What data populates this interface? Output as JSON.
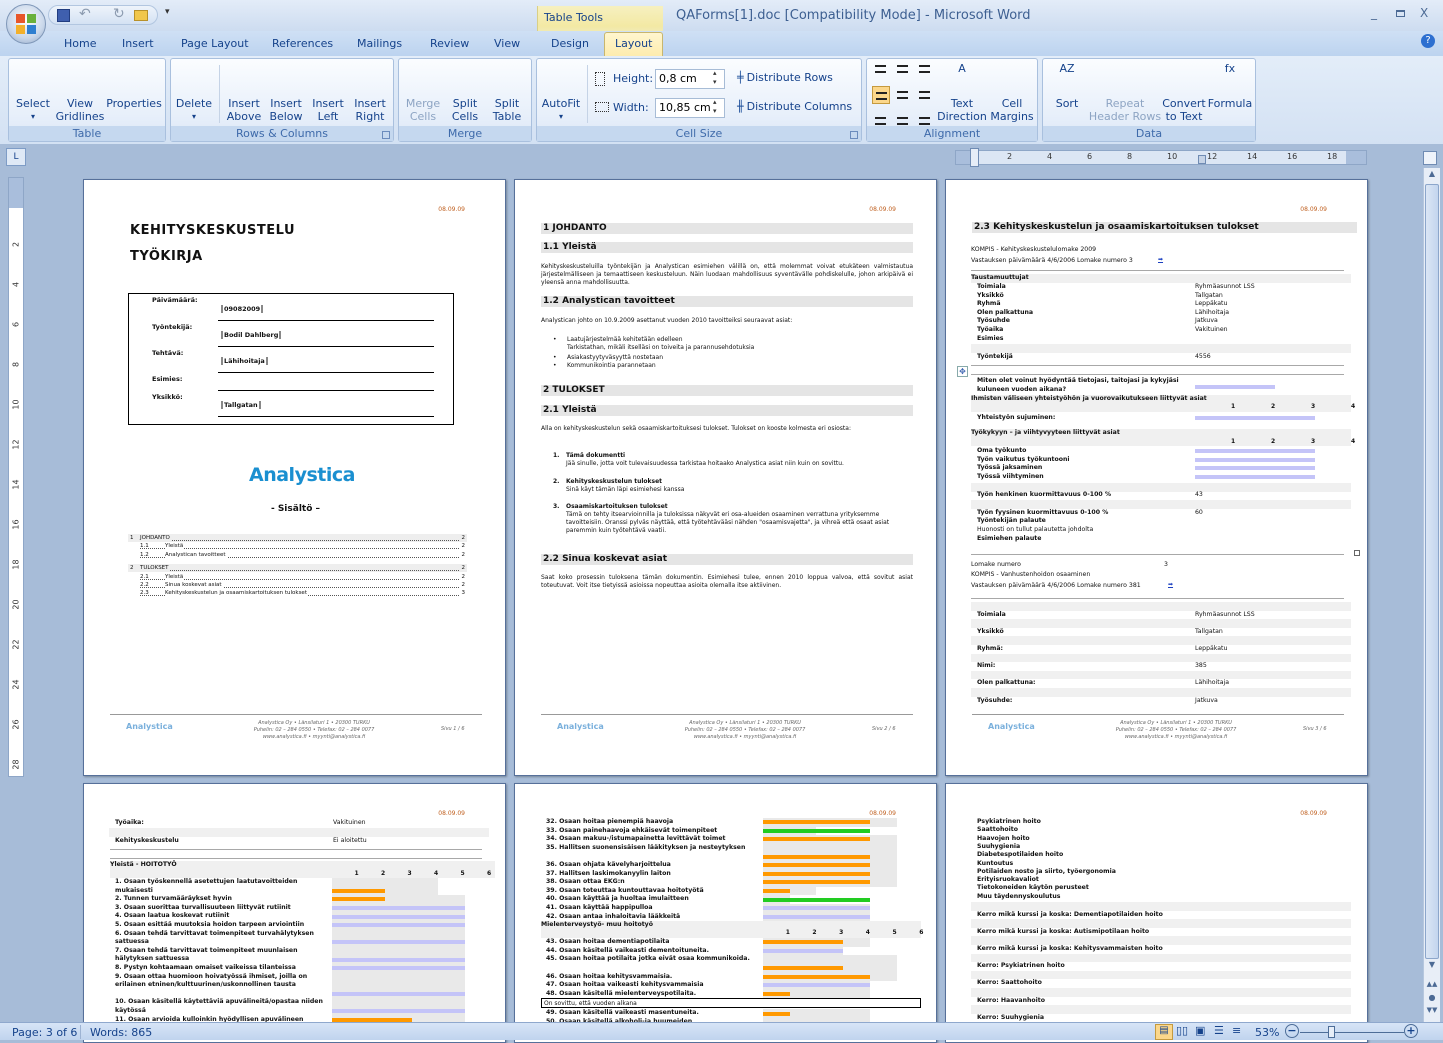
{
  "window": {
    "title": "QAForms[1].doc [Compatibility Mode] - Microsoft Word",
    "context_tab": "Table Tools"
  },
  "tabs": [
    "Home",
    "Insert",
    "Page Layout",
    "References",
    "Mailings",
    "Review",
    "View",
    "Design",
    "Layout"
  ],
  "active_tab": "Layout",
  "ribbon": {
    "groups": [
      "Table",
      "Rows & Columns",
      "Merge",
      "Cell Size",
      "Alignment",
      "Data"
    ],
    "buttons": {
      "select": "Select",
      "view_gridlines": [
        "View",
        "Gridlines"
      ],
      "properties": "Properties",
      "delete": "Delete",
      "insert_above": [
        "Insert",
        "Above"
      ],
      "insert_below": [
        "Insert",
        "Below"
      ],
      "insert_left": [
        "Insert",
        "Left"
      ],
      "insert_right": [
        "Insert",
        "Right"
      ],
      "merge_cells": [
        "Merge",
        "Cells"
      ],
      "split_cells": [
        "Split",
        "Cells"
      ],
      "split_table": [
        "Split",
        "Table"
      ],
      "autofit": "AutoFit",
      "text_direction": [
        "Text",
        "Direction"
      ],
      "cell_margins": [
        "Cell",
        "Margins"
      ],
      "sort": "Sort",
      "repeat_header_rows": [
        "Repeat",
        "Header Rows"
      ],
      "convert_to_text": [
        "Convert",
        "to Text"
      ],
      "formula": "Formula"
    },
    "cell_size": {
      "height_label": "Height:",
      "height": "0,8 cm",
      "width_label": "Width:",
      "width": "10,85 cm",
      "distribute_rows": "Distribute Rows",
      "distribute_columns": "Distribute Columns"
    },
    "disabled": [
      "merge_cells",
      "repeat_header_rows"
    ]
  },
  "ruler": {
    "h": [
      "2",
      "4",
      "6",
      "8",
      "10",
      "12",
      "14",
      "16",
      "18"
    ],
    "v": [
      "2",
      "4",
      "6",
      "8",
      "10",
      "12",
      "14",
      "16",
      "18",
      "20",
      "22",
      "24",
      "26",
      "28"
    ]
  },
  "footer": {
    "logo": "Analystica",
    "line1": "Analystica Oy • Länsilaturi 1 • 20300 TURKU",
    "line2": "Puhelin: 02 – 284 0550 • Telefax: 02 – 284 0077",
    "line3": "www.analystica.fi • myynti@analystica.fi"
  },
  "date": "08.09.09",
  "p1": {
    "title1": "KEHITYSKESKUSTELU",
    "title2": "TYÖKIRJA",
    "form": [
      [
        "Päivämäärä:",
        "09082009"
      ],
      [
        "Työntekijä:",
        "Bodil Dahlberg"
      ],
      [
        "Tehtävä:",
        "Lähihoitaja"
      ],
      [
        "Esimies:",
        ""
      ],
      [
        "Yksikkö:",
        "Tallgatan"
      ]
    ],
    "logo": "Analystica",
    "toc_title": "- Sisältö –",
    "toc": [
      [
        "1",
        "JOHDANTO",
        "2",
        true
      ],
      [
        "1.1",
        "Yleistä",
        "2",
        false
      ],
      [
        "1.2",
        "Analystican tavoitteet",
        "2",
        false
      ],
      [
        "2",
        "TULOKSET",
        "2",
        true
      ],
      [
        "2.1",
        "Yleistä",
        "2",
        false
      ],
      [
        "2.2",
        "Sinua koskevat asiat",
        "2",
        false
      ],
      [
        "2.3",
        "Kehityskeskustelun ja osaamiskartoituksen tulokset",
        "3",
        false
      ]
    ],
    "page_no": "Sivu 1 / 6"
  },
  "p2": {
    "h1": "1   JOHDANTO",
    "h11": "1.1   Yleistä",
    "p11": "Kehityskeskusteluilla työntekijän ja Analystican esimiehen välillä on, että molemmat voivat etukäteen valmistautua järjestelmälliseen ja temaattiseen keskusteluun. Näin luodaan mahdollisuus syventävälle pohdiskelulle, johon arkipäivä ei yleensä anna mahdollisuutta.",
    "h12": "1.2   Analystican tavoitteet",
    "p12": "Analystican johto on 10.9.2009 asettanut vuoden 2010 tavoitteiksi seuraavat asiat:",
    "bullets": [
      "Laatujärjestelmää kehitetään edelleen\nTarkistathan, mikäli itselläsi on toiveita ja parannusehdotuksia",
      "Asiakastyytyväsyyttä nostetaan",
      "Kommunikointia parannetaan"
    ],
    "h2": "2   TULOKSET",
    "h21": "2.1   Yleistä",
    "p21": "Alla on kehityskeskustelun sekä osaamiskartoituksesi tulokset. Tulokset on kooste kolmesta eri osiosta:",
    "numbered": [
      [
        "Tämä dokumentti",
        "Jää sinulle, jotta voit tulevaisuudessa tarkistaa hoitaako Analystica asiat niin kuin on sovittu."
      ],
      [
        "Kehityskeskustelun tulokset",
        "Sinä käyt tämän läpi esimiehesi kanssa"
      ],
      [
        "Osaamiskartoituksen tulokset",
        "Tämä on tehty itsearvioinnilla ja tuloksissa näkyvät eri osa-alueiden osaaminen verrattuna yrityksemme tavoitteisiin. Oranssi pylväs näyttää, että työtehtävääsi nähden \"osaamisvajetta\", ja vihreä että osaat asiat paremmin kuin työtehtävä vaatii."
      ]
    ],
    "h22": "2.2   Sinua koskevat asiat",
    "p22": "Saat koko prosessin tuloksena tämän dokumentin. Esimiehesi tulee, ennen 2010 loppua valvoa, että sovitut asiat toteutuvat. Voit itse tietyissä asioissa nopeuttaa asioita olemalla itse aktiivinen.",
    "page_no": "Sivu 2 / 6"
  },
  "p3": {
    "heading": "2.3   Kehityskeskustelun ja osaamiskartoituksen tulokset",
    "form1": "KOMPIS - Kehityskeskustelulomake  2009",
    "resp1": "Vastauksen päivämäärä  4/6/2006   Lomake numero  3",
    "bg_title": "Taustamuuttujat",
    "bg_rows": [
      [
        "Toimiala",
        "Ryhmäasunnot  LSS"
      ],
      [
        "Yksikkö",
        "Tallgatan"
      ],
      [
        "Ryhmä",
        "Leppäkatu"
      ],
      [
        "Olen palkattuna",
        "Lähihoitaja"
      ],
      [
        "Työsuhde",
        "Jatkuva"
      ],
      [
        "Työaika",
        "Vakituinen"
      ],
      [
        "Esimies",
        ""
      ]
    ],
    "employee": [
      "Työntekijä",
      "4556"
    ],
    "q1": "Miten olet voinut hyödyntää tietojasi, taitojasi ja kykyjäsi kuluneen vuoden aikana?",
    "q1_value": 2,
    "sec2": "Ihmisten väliseen yhteistyöhön ja vuorovaikutukseen liittyvät asiat",
    "scale": [
      "1",
      "2",
      "3",
      "4"
    ],
    "q2": [
      "Yhteistyön sujuminen:",
      3
    ],
    "sec3": "Työkykyyn – ja viihtyvyyteen liittyvät asiat",
    "q3": [
      [
        "Oma työkunto",
        3
      ],
      [
        "Työn vaikutus työkuntooni",
        3
      ],
      [
        "Työssä jaksaminen",
        3
      ],
      [
        "Työssä viihtyminen",
        3
      ]
    ],
    "mental": [
      "Työn henkinen kuormittavuus 0-100 %",
      "43"
    ],
    "physical": [
      "Työn fyysinen kuormittavuus 0-100 %",
      "60"
    ],
    "emp_feedback_label": "Työntekijän palaute",
    "emp_feedback": "Huonosti on tullut palautetta johdolta",
    "sup_feedback_label": "Esimiehen palaute",
    "form2_no": [
      "Lomake numero",
      "3"
    ],
    "form2": "KOMPIS - Vanhustenhoidon  osaaminen",
    "resp2": "Vastauksen päivämäärä  4/6/2006   Lomake numero  381",
    "rows2": [
      [
        "Toimiala",
        "Ryhmäasunnot  LSS"
      ],
      [
        "Yksikkö",
        "Tallgatan"
      ],
      [
        "Ryhmä:",
        "Leppäkatu"
      ],
      [
        "Nimi:",
        "385"
      ],
      [
        "Olen palkattuna:",
        "Lähihoitaja"
      ],
      [
        "Työsuhde:",
        "Jatkuva"
      ]
    ],
    "page_no": "Sivu 3 / 6"
  },
  "colors": {
    "gap": "#ff9900",
    "surplus": "#22cc22",
    "match": "#c4c4f8",
    "target": "#e9e9e9",
    "accent": "#15428b"
  },
  "p4": {
    "rows": [
      [
        "Työaika:",
        "Vakituinen"
      ],
      [
        "Kehityskeskustelu",
        "Ei aloitettu"
      ]
    ],
    "section": "Yleistä - HOITOTYÖ",
    "scale": [
      "1",
      "2",
      "3",
      "4",
      "5",
      "6"
    ],
    "items": [
      {
        "text": "1. Osaan työskennellä asetettujen laatutavoitteiden mukaisesti",
        "lines": 2,
        "value": 2,
        "color": "gap",
        "target": 4
      },
      {
        "text": "2. Tunnen turvamääräykset hyvin",
        "lines": 1,
        "value": 2,
        "color": "gap",
        "target": 5
      },
      {
        "text": "3. Osaan suorittaa turvallisuuteen liittyvät rutiinit",
        "lines": 1,
        "value": 5,
        "color": "match",
        "target": 5
      },
      {
        "text": "4. Osaan laatua koskevat rutiinit",
        "lines": 1,
        "value": 5,
        "color": "match",
        "target": 5
      },
      {
        "text": "5. Osaan esittää muutoksia hoidon tarpeen arviointiin",
        "lines": 1,
        "value": 5,
        "color": "match",
        "target": 5
      },
      {
        "text": "6. Osaan tehdä tarvittavat toimenpiteet turvahälytyksen sattuessa",
        "lines": 2,
        "value": 5,
        "color": "match",
        "target": 5
      },
      {
        "text": "7. Osaan tehdä tarvittavat toimenpiteet muunlaisen hälytyksen sattuessa",
        "lines": 2,
        "value": 5,
        "color": "match",
        "target": 5
      },
      {
        "text": "8. Pystyn kohtaamaan omaiset vaikeissa tilanteissa",
        "lines": 1,
        "value": 5,
        "color": "match",
        "target": 5
      },
      {
        "text": "9. Osaan ottaa huomioon hoivatyössä ihmiset, joilla on erilainen etninen/kulttuurinen/uskonnollinen tausta",
        "lines": 3,
        "value": 5,
        "color": "match",
        "target": 5
      },
      {
        "text": "10. Osaan käsitellä käytettäviä apuvälineitä/opastaa niiden käytössä",
        "lines": 2,
        "value": 5,
        "color": "match",
        "target": 5
      },
      {
        "text": "11. Osaan arvioida kulloinkin hyödyllisen apuvälineen",
        "lines": 1,
        "value": 3,
        "color": "gap",
        "target": 5
      }
    ]
  },
  "p5": {
    "items": [
      {
        "text": "32. Osaan hoitaa pienempiä haavoja",
        "lines": 1,
        "value": 4,
        "color": "gap",
        "target": 5
      },
      {
        "text": "33. Osaan painehaavoja ehkäisevät toimenpiteet",
        "lines": 1,
        "value": 4,
        "color": "surplus",
        "target": 2
      },
      {
        "text": "34. Osaan makuu-/istumapainetta levittävät toimet",
        "lines": 1,
        "value": 4,
        "color": "gap",
        "target": 5
      },
      {
        "text": "35. Hallitsen suonensisäisen lääkityksen ja nesteytyksen",
        "lines": 2,
        "value": 4,
        "color": "gap",
        "target": 5
      },
      {
        "text": "36. Osaan ohjata kävelyharjoittelua",
        "lines": 1,
        "value": 4,
        "color": "gap",
        "target": 5
      },
      {
        "text": "37. Hallitsen laskimokanyylin laiton",
        "lines": 1,
        "value": 4,
        "color": "gap",
        "target": 5
      },
      {
        "text": "38. Osaan ottaa EKG:n",
        "lines": 1,
        "value": 4,
        "color": "gap",
        "target": 5
      },
      {
        "text": "39. Osaan toteuttaa kuntouttavaa hoitotyötä",
        "lines": 1,
        "value": 1,
        "color": "gap",
        "target": 2
      },
      {
        "text": "40. Osaan käyttää ja huoltaa imulaitteen",
        "lines": 1,
        "value": 4,
        "color": "surplus",
        "target": 1
      },
      {
        "text": "41. Osaan käyttää happipulloa",
        "lines": 1,
        "value": 4,
        "color": "match",
        "target": 4
      },
      {
        "text": "42. Osaan antaa inhaloitavia lääkkeitä",
        "lines": 1,
        "value": 4,
        "color": "match",
        "target": 4
      },
      {
        "section": "Mielenterveystyö- muu hoitotyö",
        "scale": [
          "1",
          "2",
          "3",
          "4",
          "5",
          "6"
        ]
      },
      {
        "text": "43. Osaan hoitaa dementiapotilaita",
        "lines": 1,
        "value": 3,
        "color": "gap",
        "target": 4
      },
      {
        "text": "44. Osaan käsitellä vaikeasti dementoituneita.",
        "lines": 1,
        "value": 3,
        "color": "match",
        "target": 3
      },
      {
        "text": "45. Osaan hoitaa potilaita jotka eivät osaa kommunikoida.",
        "lines": 2,
        "value": 3,
        "color": "gap",
        "target": 5
      },
      {
        "text": "46. Osaan hoitaa kehitysvammaisia.",
        "lines": 1,
        "value": 4,
        "color": "gap",
        "target": 5
      },
      {
        "text": "47. Osaan hoitaa vaikeasti kehitysvammaisia",
        "lines": 1,
        "value": 4,
        "color": "match",
        "target": 4
      },
      {
        "text": "48. Osaan käsitellä mielenterveyspotilaita.",
        "lines": 1,
        "value": 1,
        "color": "gap",
        "target": 4
      },
      {
        "comment": "On sovittu, että vuoden  alkana"
      },
      {
        "text": "49. Osaan käsitellä vaikeasti masentuneita.",
        "lines": 1,
        "value": 1,
        "color": "gap",
        "target": 4
      },
      {
        "text": "50. Osaan käsitellä alkoholi-ja huumeiden",
        "lines": 1,
        "value": 0,
        "color": "gap",
        "target": 4
      }
    ]
  },
  "p6": {
    "list": [
      "Psykiatrinen hoito",
      "Saattohoito",
      "Haavojen hoito",
      "Suuhygienia",
      "Diabetespotilaiden hoito",
      "Kuntoutus",
      "Potilaiden nosto ja siirto,  työergonomia",
      "Erityisruokavaliot",
      "Tietokoneiden käytön perusteet",
      "Muu täydennyskoulutus"
    ],
    "rows": [
      "Kerro mikä kurssi ja koska: Dementiapotilaiden hoito",
      "Kerro mikä kurssi ja koska: Autismipotilaan  hoito",
      "Kerro mikä kurssi ja koska: Kehitysvammaisten hoito",
      "Kerro: Psykiatrinen  hoito",
      "Kerro: Saattohoito",
      "Kerro: Haavanhoito",
      "Kerro: Suuhygienia"
    ]
  },
  "status": {
    "page": "Page: 3 of 6",
    "words": "Words: 865",
    "zoom": "53%",
    "zoom_percent": 53
  }
}
